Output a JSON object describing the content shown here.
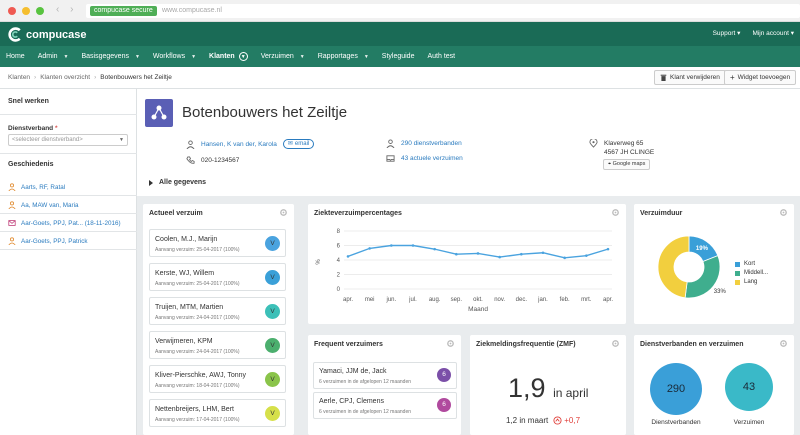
{
  "browser": {
    "secure": "compucase secure",
    "url": "www.compucase.nl"
  },
  "header": {
    "logo": "compucase",
    "support": "Support ▾",
    "account": "Mijn account ▾"
  },
  "menu": [
    {
      "label": "Home",
      "chev": ""
    },
    {
      "label": "Admin",
      "chev": "▼"
    },
    {
      "label": "Basisgegevens",
      "chev": "▼"
    },
    {
      "label": "Workflows",
      "chev": "▼"
    },
    {
      "label": "Klanten",
      "chev": "circle",
      "active": true
    },
    {
      "label": "Verzuimen",
      "chev": "▼"
    },
    {
      "label": "Rapportages",
      "chev": "▼"
    },
    {
      "label": "Styleguide",
      "chev": ""
    },
    {
      "label": "Auth test",
      "chev": ""
    }
  ],
  "breadcrumb": [
    "Klanten",
    "Klanten overzicht",
    "Botenbouwers het Zeiltje"
  ],
  "actions": {
    "delete": "Klant verwijderen",
    "add_widget": "Widget toevoegen"
  },
  "sidebar": {
    "quick_title": "Snel werken",
    "dv_label": "Dienstverband",
    "dv_placeholder": "<selecteer dienstverband>",
    "history_title": "Geschiedenis",
    "history": [
      {
        "text": "Aarts, RF, Ratal",
        "type": "person"
      },
      {
        "text": "Aa, MAW van, Maria",
        "type": "person"
      },
      {
        "text": "Aar-Goets, PPJ, Pat... (18-11-2016)",
        "type": "mail"
      },
      {
        "text": "Aar-Goets, PPJ, Patrick",
        "type": "person"
      }
    ]
  },
  "client": {
    "name": "Botenbouwers het Zeiltje",
    "contact": "Hansen, K van der, Karola",
    "email": "email",
    "phone": "020-1234567",
    "dienstverbanden": "290 dienstverbanden",
    "verzuimen": "43 actuele verzuimen",
    "address1": "Klaverweg 65",
    "address2": "4567 JH CLINGE",
    "maps": "Google maps",
    "all_data": "Alle gegevens"
  },
  "actueel": {
    "title": "Actueel verzuim",
    "rows": [
      {
        "name": "Coolen, M.J., Marijn",
        "sub": "Aanvang verzuim: 25-04-2017 (100%)",
        "badge": "V",
        "color": "#4aa3df"
      },
      {
        "name": "Kerste, WJ, Willem",
        "sub": "Aanvang verzuim: 25-04-2017 (100%)",
        "badge": "V",
        "color": "#3aa0d8"
      },
      {
        "name": "Truijen, MTM, Martien",
        "sub": "Aanvang verzuim: 24-04-2017 (100%)",
        "badge": "V",
        "color": "#3cc0b8"
      },
      {
        "name": "Verwijmeren, KPM",
        "sub": "Aanvang verzuim: 24-04-2017 (100%)",
        "badge": "V",
        "color": "#4caf6e"
      },
      {
        "name": "Kliver-Pierschke, AWJ, Tonny",
        "sub": "Aanvang verzuim: 18-04-2017 (100%)",
        "badge": "V",
        "color": "#8ac44a"
      },
      {
        "name": "Nettenbreijers, LHM, Bert",
        "sub": "Aanvang verzuim: 17-04-2017 (100%)",
        "badge": "V",
        "color": "#d6e04a"
      }
    ]
  },
  "ziekte": {
    "title": "Ziekteverzuimpercentages",
    "chart_data": {
      "type": "line",
      "title": "",
      "xlabel": "Maand",
      "ylabel": "%",
      "categories": [
        "apr.",
        "mei",
        "jun.",
        "jul.",
        "aug.",
        "sep.",
        "okt.",
        "nov.",
        "dec.",
        "jan.",
        "feb.",
        "mrt.",
        "apr."
      ],
      "series": [
        {
          "values": [
            4.5,
            5.6,
            6.0,
            6.0,
            5.5,
            4.8,
            4.9,
            4.4,
            4.8,
            5.0,
            4.3,
            4.6,
            5.5
          ]
        }
      ],
      "ylim": [
        0,
        8
      ],
      "yticks": [
        0,
        2,
        4,
        6,
        8
      ],
      "grid": true,
      "color": "#4aa3df"
    }
  },
  "verzuimduur": {
    "title": "Verzuimduur",
    "chart_data": {
      "type": "pie",
      "categories": [
        "Kort",
        "Middell...",
        "Lang"
      ],
      "values": [
        19,
        33,
        48
      ],
      "labels": [
        "19%",
        "33%",
        ""
      ],
      "colors": [
        "#3a9fd8",
        "#3fae8e",
        "#f2cf3e"
      ],
      "legend": "right"
    }
  },
  "frequent": {
    "title": "Frequent verzuimers",
    "rows": [
      {
        "name": "Yamaci, JJM de, Jack",
        "sub": "6 verzuimen in de afgelopen 12 maanden",
        "badge": "6",
        "color": "#7b4fa8"
      },
      {
        "name": "Aerle, CPJ, Clemens",
        "sub": "6 verzuimen in de afgelopen 12 maanden",
        "badge": "6",
        "color": "#b04a9e"
      }
    ]
  },
  "zmf": {
    "title": "Ziekmeldingsfrequentie (ZMF)",
    "value": "1,9",
    "period": "in april",
    "prev": "1,2 in maart",
    "delta": "+0,7",
    "delta_color": "#e0403b"
  },
  "dv": {
    "title": "Dienstverbanden en verzuimen",
    "left_value": "290",
    "left_label": "Dienstverbanden",
    "left_color": "#3a9fd8",
    "right_value": "43",
    "right_label": "Verzuimen",
    "right_color": "#3ab9c8"
  }
}
